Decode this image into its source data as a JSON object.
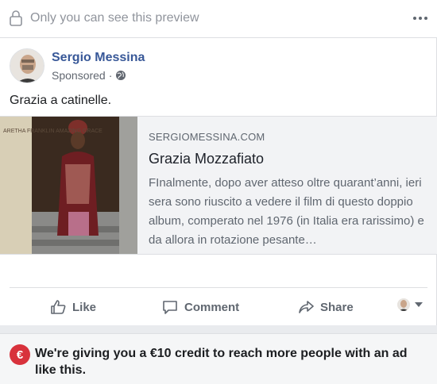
{
  "preview": {
    "text": "Only you can see this preview"
  },
  "post": {
    "author": "Sergio Messina",
    "sponsored_label": "Sponsored",
    "separator": "·",
    "text": "Grazia a catinelle."
  },
  "link": {
    "domain": "SERGIOMESSINA.COM",
    "title": "Grazia Mozzafiato",
    "description": "FInalmente, dopo aver atteso oltre quarant’anni, ieri sera sono riuscito a vedere il film di questo doppio album, comperato nel 1976 (in Italia era rarissimo) e da allora in rotazione pesante…",
    "thumbnail_text": "ARETHA FRANKLIN AMAZING GRACE"
  },
  "actions": {
    "like": "Like",
    "comment": "Comment",
    "share": "Share"
  },
  "credit": {
    "icon_symbol": "€",
    "text": "We're giving you a €10 credit to reach more people with an ad like this."
  },
  "colors": {
    "link_blue": "#385898",
    "muted": "#90949c",
    "euro_red": "#d8323c",
    "preview_bg": "#f2f3f5"
  },
  "icons": [
    "lock-icon",
    "more-icon",
    "globe-icon",
    "like-icon",
    "comment-icon",
    "share-icon",
    "caret-down-icon",
    "euro-icon"
  ]
}
